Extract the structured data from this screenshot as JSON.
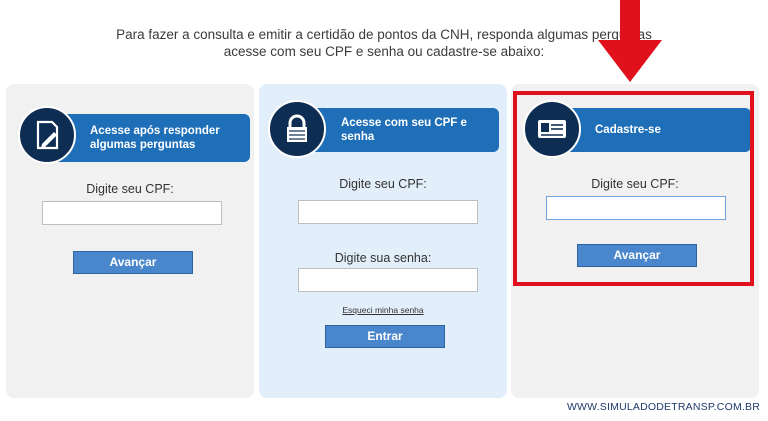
{
  "intro": {
    "line1": "Para fazer a consulta e emitir a certidão de pontos da CNH, responda algumas perguntas",
    "line2": "acesse com seu CPF e senha ou cadastre-se abaixo:"
  },
  "cards": [
    {
      "title": "Acesse após responder algumas perguntas",
      "icon": "document-pencil-icon",
      "cpf_label": "Digite seu CPF:",
      "cpf_value": "",
      "button": "Avançar"
    },
    {
      "title": "Acesse com seu CPF e senha",
      "icon": "lock-icon",
      "cpf_label": "Digite seu CPF:",
      "cpf_value": "",
      "password_label": "Digite sua senha:",
      "password_value": "",
      "forgot_link": "Esqueci minha senha",
      "button": "Entrar"
    },
    {
      "title": "Cadastre-se",
      "icon": "id-card-icon",
      "cpf_label": "Digite seu CPF:",
      "cpf_value": "",
      "button": "Avançar"
    }
  ],
  "annotation": {
    "highlight_color": "#e0101c",
    "arrow_color": "#e0101c"
  },
  "footer": {
    "watermark": "WWW.SIMULADODETRANSP.COM.BR"
  },
  "colors": {
    "badge_blue": "#1f6fb8",
    "icon_navy": "#0e2d52",
    "button_blue": "#4a86cb"
  }
}
